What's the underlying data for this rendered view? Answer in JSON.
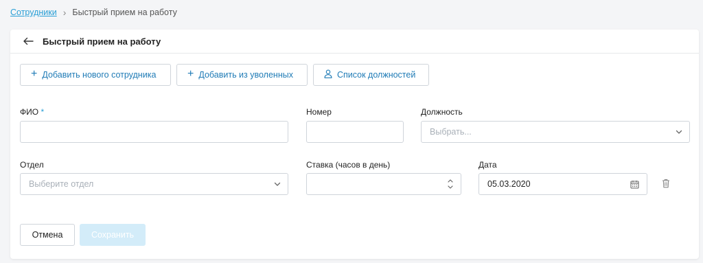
{
  "breadcrumb": {
    "parent": "Сотрудники",
    "separator": "›",
    "current": "Быстрый прием на работу"
  },
  "card": {
    "title": "Быстрый прием на работу"
  },
  "toolbar": {
    "add_new": "Добавить нового сотрудника",
    "add_fired": "Добавить из уволенных",
    "positions": "Список должностей"
  },
  "form": {
    "fio": {
      "label": "ФИО",
      "required_mark": "*",
      "value": ""
    },
    "number": {
      "label": "Номер",
      "value": ""
    },
    "position": {
      "label": "Должность",
      "placeholder": "Выбрать..."
    },
    "department": {
      "label": "Отдел",
      "placeholder": "Выберите отдел"
    },
    "rate": {
      "label": "Ставка (часов в день)",
      "value": ""
    },
    "date": {
      "label": "Дата",
      "value": "05.03.2020"
    }
  },
  "actions": {
    "cancel": "Отмена",
    "save": "Сохранить"
  },
  "icons": {
    "back": "arrow-left-icon",
    "plus": "plus-icon",
    "user": "user-icon",
    "chevron": "chevron-down-icon",
    "stepper": "stepper-icon",
    "calendar": "calendar-icon",
    "trash": "trash-icon"
  },
  "colors": {
    "accent": "#2a9fd6",
    "link": "#1f7bb6",
    "save_disabled": "#d3ecf9"
  }
}
